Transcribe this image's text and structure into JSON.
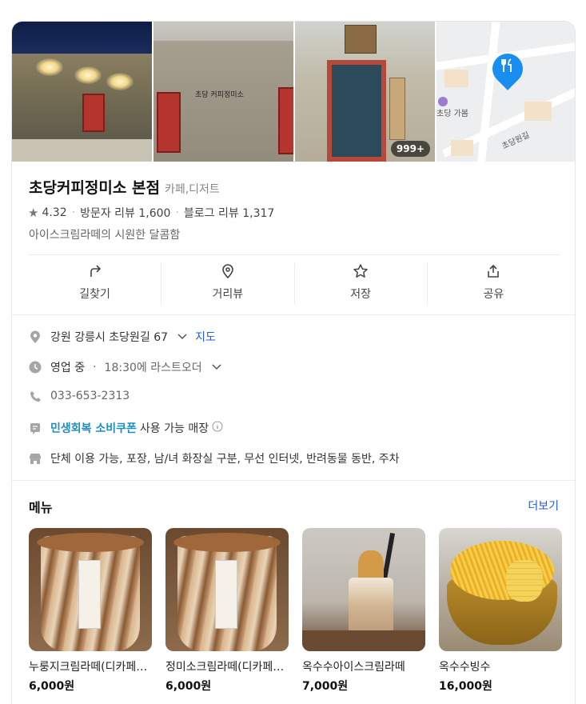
{
  "photos": {
    "count_badge": "999+",
    "sign_text_1": "초당 커피정미소",
    "sign_text_2": "초당커피정미소",
    "map_labels": [
      "초당 가봄",
      "초당원길"
    ]
  },
  "place": {
    "name": "초당커피정미소 본점",
    "category": "카페,디저트",
    "rating": "4.32",
    "visitor_reviews": "방문자 리뷰 1,600",
    "blog_reviews": "블로그 리뷰 1,317",
    "description": "아이스크림라떼의 시원한 달콤함"
  },
  "actions": [
    {
      "label": "길찾기",
      "icon": "directions-icon"
    },
    {
      "label": "거리뷰",
      "icon": "street-view-icon"
    },
    {
      "label": "저장",
      "icon": "star-icon"
    },
    {
      "label": "공유",
      "icon": "share-icon"
    }
  ],
  "info": {
    "address": "강원 강릉시 초당원길 67",
    "map_link": "지도",
    "status": "영업 중",
    "last_order": "18:30에 라스트오더",
    "phone": "033-653-2313",
    "coupon_link": "민생회복 소비쿠폰",
    "coupon_text": "사용 가능 매장",
    "amenities": "단체 이용 가능, 포장, 남/녀 화장실 구분, 무선 인터넷, 반려동물 동반, 주차"
  },
  "menu": {
    "title": "메뉴",
    "more": "더보기",
    "items": [
      {
        "name": "누룽지크림라떼(디카페인 가능)",
        "price": "6,000원"
      },
      {
        "name": "정미소크림라떼(디카페인 가능)",
        "price": "6,000원"
      },
      {
        "name": "옥수수아이스크림라떼",
        "price": "7,000원"
      },
      {
        "name": "옥수수빙수",
        "price": "16,000원"
      }
    ]
  },
  "colors": {
    "link_blue": "#1f5fd1",
    "coupon_teal": "#1b8fbf",
    "map_pin": "#1a8ef0"
  }
}
